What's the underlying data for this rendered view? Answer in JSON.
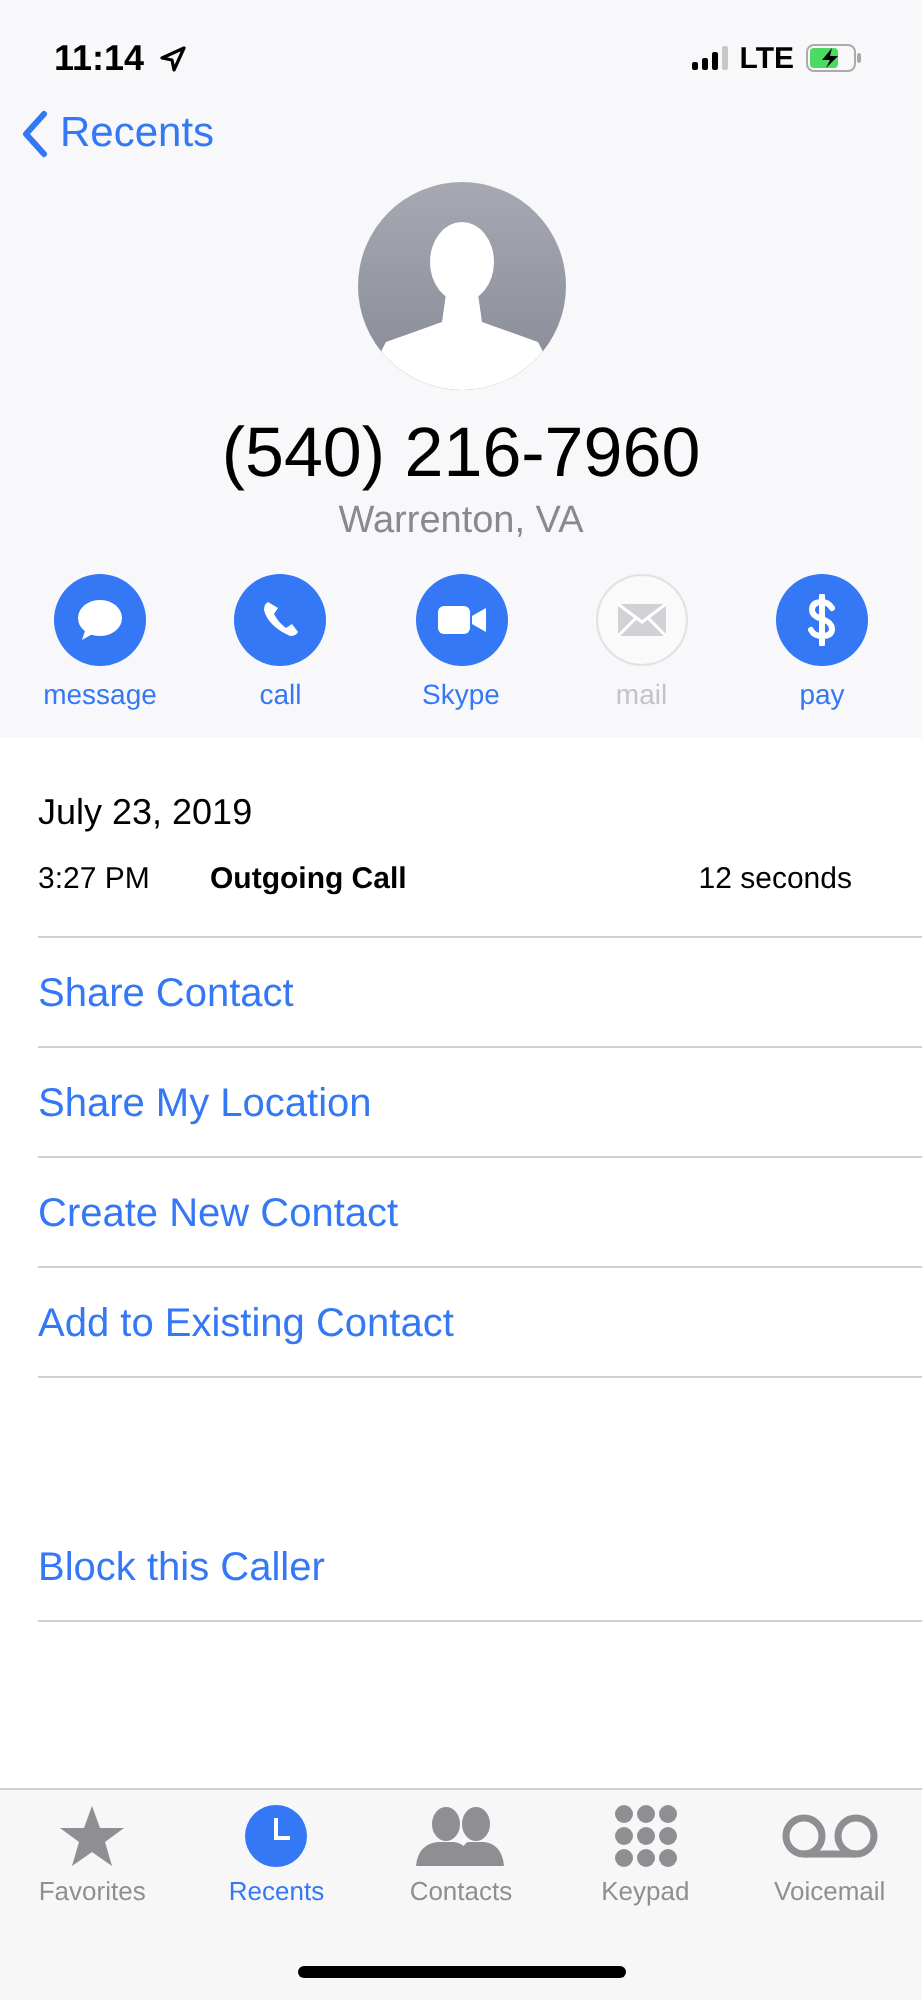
{
  "status_bar": {
    "time": "11:14",
    "network": "LTE"
  },
  "nav": {
    "back": "Recents"
  },
  "contact": {
    "number": "(540) 216-7960",
    "location": "Warrenton, VA"
  },
  "actions": [
    {
      "label": "message",
      "disabled": false
    },
    {
      "label": "call",
      "disabled": false
    },
    {
      "label": "Skype",
      "disabled": false
    },
    {
      "label": "mail",
      "disabled": true
    },
    {
      "label": "pay",
      "disabled": false
    }
  ],
  "call_log": {
    "date": "July 23, 2019",
    "time": "3:27 PM",
    "type": "Outgoing Call",
    "duration": "12 seconds"
  },
  "options": [
    "Share Contact",
    "Share My Location",
    "Create New Contact",
    "Add to Existing Contact"
  ],
  "block": "Block this Caller",
  "tabs": [
    {
      "label": "Favorites",
      "selected": false
    },
    {
      "label": "Recents",
      "selected": true
    },
    {
      "label": "Contacts",
      "selected": false
    },
    {
      "label": "Keypad",
      "selected": false
    },
    {
      "label": "Voicemail",
      "selected": false
    }
  ]
}
